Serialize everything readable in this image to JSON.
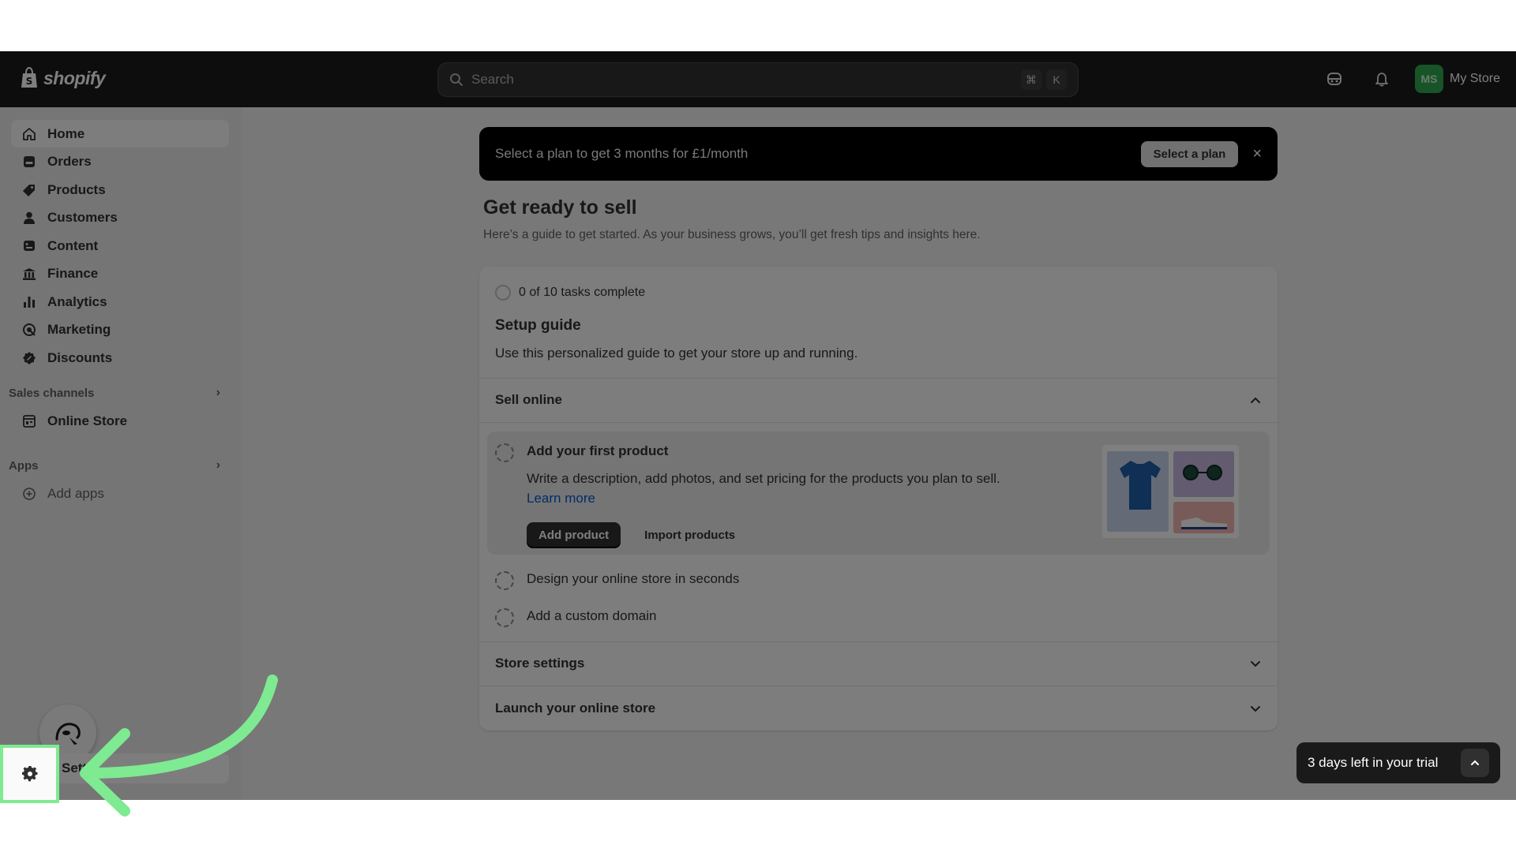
{
  "topbar": {
    "brand": "shopify",
    "search_placeholder": "Search",
    "shortcut": [
      "⌘",
      "K"
    ],
    "avatar_initials": "MS",
    "store_name": "My Store"
  },
  "sidebar": {
    "items": [
      {
        "label": "Home",
        "icon": "home-icon"
      },
      {
        "label": "Orders",
        "icon": "orders-icon"
      },
      {
        "label": "Products",
        "icon": "tag-icon"
      },
      {
        "label": "Customers",
        "icon": "person-icon"
      },
      {
        "label": "Content",
        "icon": "content-icon"
      },
      {
        "label": "Finance",
        "icon": "bank-icon"
      },
      {
        "label": "Analytics",
        "icon": "bar-chart-icon"
      },
      {
        "label": "Marketing",
        "icon": "target-icon"
      },
      {
        "label": "Discounts",
        "icon": "discount-icon"
      }
    ],
    "sales_channels": {
      "header": "Sales channels",
      "items": [
        "Online Store"
      ]
    },
    "apps": {
      "header": "Apps",
      "items": [
        "Add apps"
      ]
    },
    "settings_label": "Settin"
  },
  "banner": {
    "text": "Select a plan to get 3 months for £1/month",
    "button": "Select a plan",
    "close": "×"
  },
  "page": {
    "title": "Get ready to sell",
    "subtitle": "Here’s a guide to get started. As your business grows, you’ll get fresh tips and insights here."
  },
  "setup_guide": {
    "progress": "0 of 10 tasks complete",
    "title": "Setup guide",
    "description": "Use this personalized guide to get your store up and running.",
    "sections": {
      "sell_online": {
        "title": "Sell online",
        "tasks": {
          "first": {
            "title": "Add your first product",
            "text": "Write a description, add photos, and set pricing for the products you plan to sell.",
            "link": "Learn more",
            "primary": "Add product",
            "secondary": "Import products"
          },
          "design": "Design your online store in seconds",
          "domain": "Add a custom domain"
        }
      },
      "store_settings": "Store settings",
      "launch": "Launch your online store"
    }
  },
  "trial": {
    "text": "3 days left in your trial"
  },
  "colors": {
    "highlight": "#7eea91",
    "avatar": "#2fa84f",
    "link": "#005bd3"
  }
}
